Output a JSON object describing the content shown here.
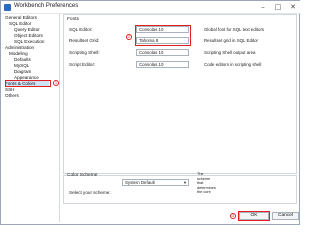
{
  "window": {
    "title": "Workbench Preferences",
    "minimize": "–",
    "maximize": "□",
    "close": "✕"
  },
  "tree": [
    "General Editors",
    "SQL Editor",
    "Query Editor",
    "Object Editors",
    "SQL Execution",
    "Administration",
    "Modeling",
    "Defaults",
    "MySQL",
    "Diagram",
    "Appearance",
    "Fonts & Colors",
    "SSH",
    "Others"
  ],
  "fonts": {
    "group_label": "Fonts",
    "rows": [
      {
        "label": "SQL Editor:",
        "value": "Consolas 10",
        "desc": "Global font for SQL text editors"
      },
      {
        "label": "Resultset Grid:",
        "value": "Tahoma 8",
        "desc": "Resultset grid in SQL Editor"
      },
      {
        "label": "Scripting Shell:",
        "value": "Consolas 10",
        "desc": "Scripting Shell output area"
      },
      {
        "label": "Script Editor:",
        "value": "Consolas 10",
        "desc": "Code editors in scripting shell"
      }
    ]
  },
  "scheme": {
    "group_label": "Color Scheme",
    "select_label": "Select your scheme:",
    "selected": "System Default",
    "note": "The scheme that determines the core"
  },
  "buttons": {
    "ok": "OK",
    "cancel": "Cancel"
  },
  "callouts": {
    "one": "1",
    "two": "2",
    "three": "3"
  },
  "colors": {
    "callout": "#e02020",
    "selection": "#cfe3f7",
    "icon_blue": "#2a6cc4"
  }
}
